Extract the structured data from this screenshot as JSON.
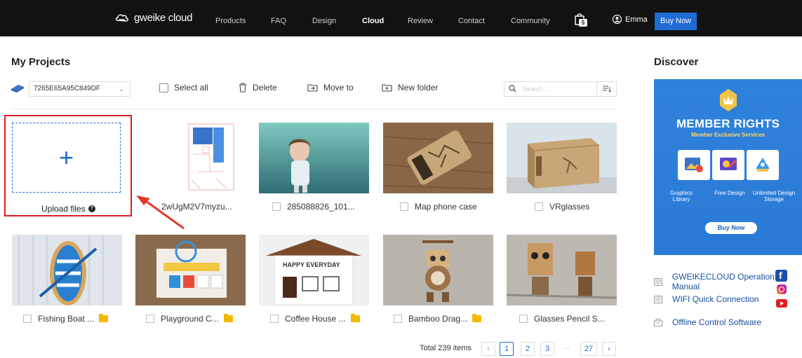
{
  "nav": {
    "brand": "gweike cloud",
    "items": [
      "Products",
      "FAQ",
      "Design",
      "Cloud",
      "Review",
      "Contact",
      "Community"
    ],
    "active": "Cloud",
    "cart_count": "5",
    "user_name": "Emma",
    "buy_now": "Buy Now"
  },
  "projects": {
    "title": "My Projects",
    "device_id": "7265E65A95C849DF",
    "toolbar": {
      "select_all": "Select all",
      "delete": "Delete",
      "move_to": "Move to",
      "new_folder": "New folder"
    },
    "search_placeholder": "Search...",
    "upload_label": "Upload files",
    "items": [
      {
        "name": "2wUgM2V7myzu...",
        "folder": false
      },
      {
        "name": "285088826_101...",
        "folder": false
      },
      {
        "name": "Map phone case",
        "folder": false
      },
      {
        "name": "VRglasses",
        "folder": false
      },
      {
        "name": "Fishing Boat ...",
        "folder": true
      },
      {
        "name": "Playground C...",
        "folder": true
      },
      {
        "name": "Coffee House ...",
        "folder": true
      },
      {
        "name": "Bamboo Drag...",
        "folder": true
      },
      {
        "name": "Glasses Pencil S...",
        "folder": false
      }
    ],
    "pagination": {
      "total": "Total 239 items",
      "pages": [
        "1",
        "2",
        "3",
        "27"
      ],
      "current": "1",
      "ellipsis": "···"
    }
  },
  "discover": {
    "title": "Discover",
    "banner": {
      "title": "MEMBER RIGHTS",
      "subtitle": "Member Exclusive Services",
      "features": [
        "Graphics Library",
        "Free Design",
        "Unlimited Design Storage"
      ],
      "buy_now": "Buy Now"
    },
    "links": [
      {
        "label": "GWEIKECLOUD Operation Manual",
        "icon": "book-icon"
      },
      {
        "label": "WIFI Quick Connection",
        "icon": "book-icon"
      },
      {
        "label": "Offline Control Software",
        "icon": "software-icon"
      }
    ]
  },
  "colors": {
    "topbar": "#121212",
    "accent": "#1e6bd6",
    "highlight": "#d62020",
    "folder": "#f5b800"
  }
}
